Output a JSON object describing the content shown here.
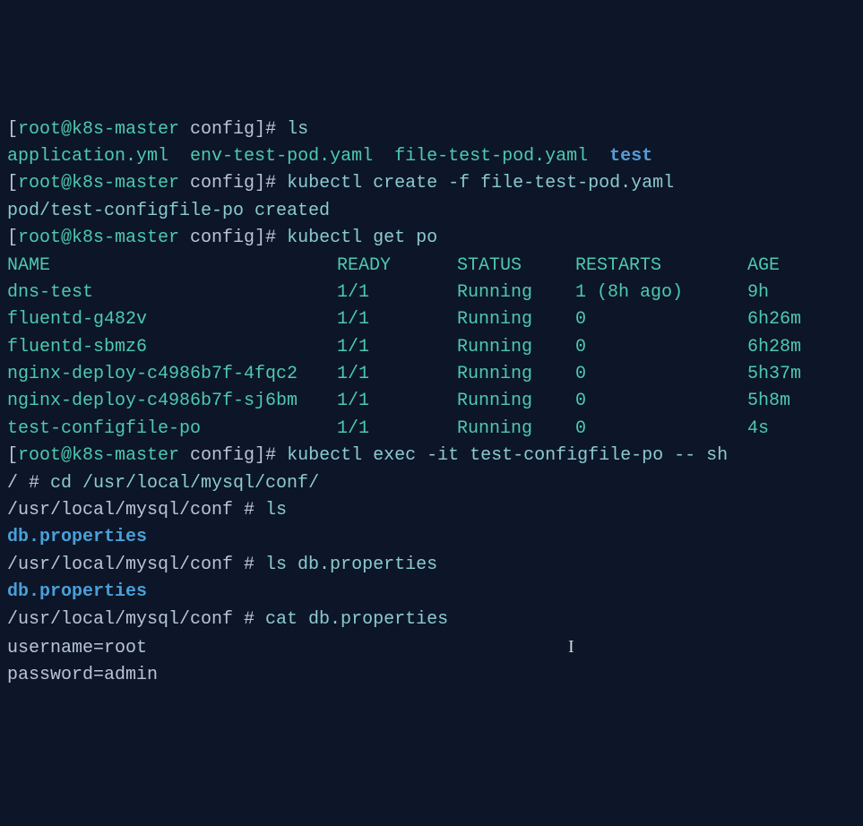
{
  "lines": {
    "p1": {
      "bracket_open": "[",
      "user_host": "root@k8s-master",
      "dir": " config",
      "bracket_close": "]# ",
      "cmd": "ls"
    },
    "ls_out": {
      "f1": "application.yml  ",
      "f2": "env-test-pod.yaml  ",
      "f3": "file-test-pod.yaml  ",
      "f4": "test"
    },
    "p2": {
      "bracket_open": "[",
      "user_host": "root@k8s-master",
      "dir": " config",
      "bracket_close": "]# ",
      "cmd": "kubectl create -f file-test-pod.yaml"
    },
    "create_out": "pod/test-configfile-po created",
    "p3": {
      "bracket_open": "[",
      "user_host": "root@k8s-master",
      "dir": " config",
      "bracket_close": "]# ",
      "cmd": "kubectl get po"
    },
    "header": {
      "name": "NAME",
      "ready": "READY",
      "status": "STATUS",
      "restarts": "RESTARTS",
      "age": "AGE"
    },
    "rows": [
      {
        "name": "dns-test",
        "ready": "1/1",
        "status": "Running",
        "restarts": "1 (8h ago)",
        "age": "9h"
      },
      {
        "name": "fluentd-g482v",
        "ready": "1/1",
        "status": "Running",
        "restarts": "0",
        "age": "6h26m"
      },
      {
        "name": "fluentd-sbmz6",
        "ready": "1/1",
        "status": "Running",
        "restarts": "0",
        "age": "6h28m"
      },
      {
        "name": "nginx-deploy-c4986b7f-4fqc2",
        "ready": "1/1",
        "status": "Running",
        "restarts": "0",
        "age": "5h37m"
      },
      {
        "name": "nginx-deploy-c4986b7f-sj6bm",
        "ready": "1/1",
        "status": "Running",
        "restarts": "0",
        "age": "5h8m"
      },
      {
        "name": "test-configfile-po",
        "ready": "1/1",
        "status": "Running",
        "restarts": "0",
        "age": "4s"
      }
    ],
    "p4": {
      "bracket_open": "[",
      "user_host": "root@k8s-master",
      "dir": " config",
      "bracket_close": "]# ",
      "cmd": "kubectl exec -it test-configfile-po -- sh"
    },
    "sh1": {
      "prompt": "/ # ",
      "cmd": "cd /usr/local/mysql/conf/"
    },
    "sh2": {
      "prompt": "/usr/local/mysql/conf # ",
      "cmd": "ls"
    },
    "sh2_out": "db.properties",
    "sh3": {
      "prompt": "/usr/local/mysql/conf # ",
      "cmd": "ls db.properties"
    },
    "sh3_out": "db.properties",
    "sh4": {
      "prompt": "/usr/local/mysql/conf # ",
      "cmd": "cat db.properties"
    },
    "cat_out1": "username=root",
    "cat_out2": "password=admin"
  }
}
